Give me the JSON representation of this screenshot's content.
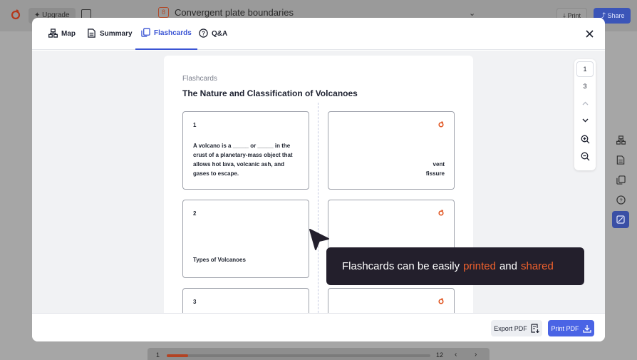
{
  "background": {
    "upgrade_label": "Upgrade",
    "doc_number": "8",
    "doc_title": "Convergent plate boundaries",
    "print_label": "Print",
    "share_label": "Share",
    "footer": {
      "current_page": "1",
      "total_pages": "12",
      "progress": 0.08
    }
  },
  "modal": {
    "tabs": [
      {
        "label": "Map",
        "icon": "map-icon",
        "active": false
      },
      {
        "label": "Summary",
        "icon": "summary-icon",
        "active": false
      },
      {
        "label": "Flashcards",
        "icon": "flashcards-icon",
        "active": true
      },
      {
        "label": "Q&A",
        "icon": "qa-icon",
        "active": false
      }
    ],
    "sheet": {
      "kicker": "Flashcards",
      "title": "The Nature and Classification of Volcanoes",
      "cards": [
        {
          "number": "1",
          "question": "A volcano is a _____ or _____ in the crust of a planetary-mass object that allows hot lava, volcanic ash, and gases to escape.",
          "answer_lines": [
            "vent",
            "fissure"
          ]
        },
        {
          "number": "2",
          "question": "Types of Volcanoes",
          "answer_lines": []
        },
        {
          "number": "3",
          "question": "",
          "answer_lines": []
        }
      ]
    },
    "pager": {
      "current": "1",
      "total": "3"
    },
    "footer": {
      "export_label": "Export PDF",
      "print_label": "Print PDF"
    }
  },
  "tooltip": {
    "text_before": "Flashcards can be easily",
    "highlight_1": "printed",
    "text_middle": "and",
    "highlight_2": "shared",
    "highlight_color": "#f0612d"
  },
  "colors": {
    "accent": "#3a54d4",
    "brand": "#e0531f",
    "tooltip_bg": "#231f2c"
  }
}
